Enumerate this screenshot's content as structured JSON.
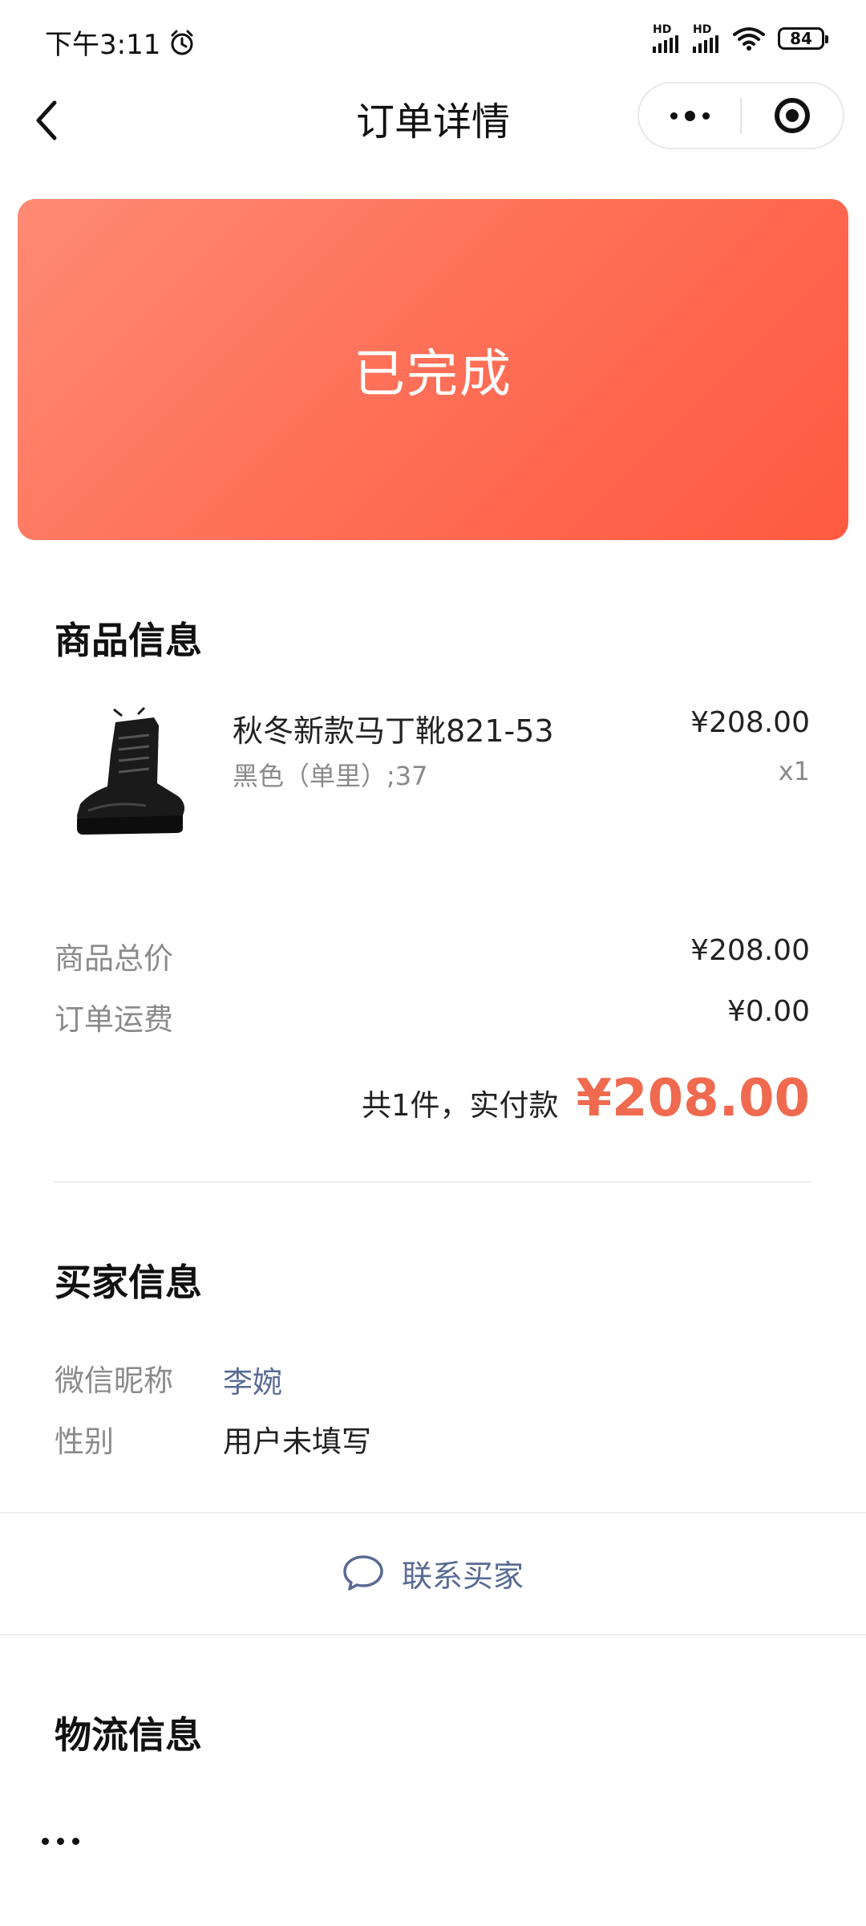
{
  "status_bar": {
    "time": "下午3:11",
    "signal_1_label": "HD",
    "signal_2_label": "HD",
    "battery": "84"
  },
  "nav": {
    "title": "订单详情",
    "back_icon": "chevron-left-icon",
    "more_icon": "more-dots-icon",
    "close_icon": "target-icon"
  },
  "order_status": {
    "label": "已完成",
    "gradient_colors": [
      "#ff8a73",
      "#ff5a40"
    ]
  },
  "product_section": {
    "title": "商品信息",
    "item": {
      "name": "秋冬新款马丁靴821-53",
      "spec": "黑色（单里）;37",
      "price": "¥208.00",
      "quantity": "x1",
      "image": "black-martin-boot-image"
    },
    "subtotal_label": "商品总价",
    "subtotal_value": "¥208.00",
    "shipping_label": "订单运费",
    "shipping_value": "¥0.00",
    "total_label": "共1件，实付款",
    "total_value": "¥208.00",
    "accent_color": "#ef6a4f"
  },
  "buyer_section": {
    "title": "买家信息",
    "nickname_label": "微信昵称",
    "nickname_value": "李婉",
    "gender_label": "性别",
    "gender_value": "用户未填写",
    "contact_label": "联系买家",
    "contact_icon": "chat-bubble-icon",
    "link_color": "#586b94"
  },
  "logistics_section": {
    "title": "物流信息"
  },
  "bottom_bar": {
    "more_icon": "more-dots-icon"
  }
}
